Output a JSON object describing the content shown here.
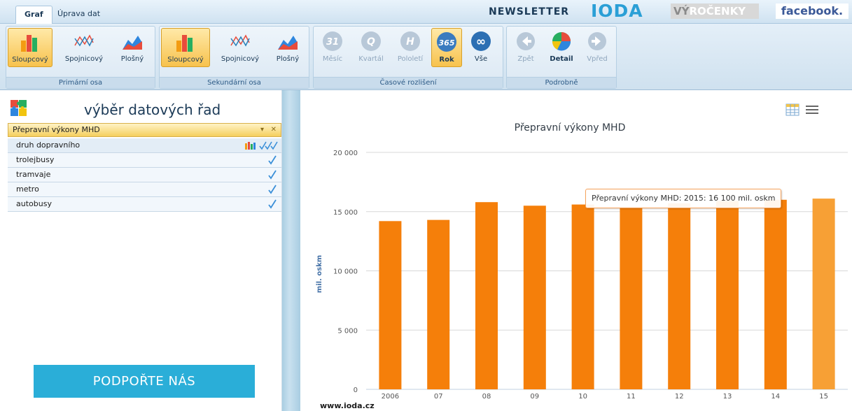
{
  "tabs": [
    {
      "label": "Graf",
      "active": true
    },
    {
      "label": "Úprava dat",
      "active": false
    }
  ],
  "toplinks": {
    "newsletter": "NEWSLETTER",
    "ioda": "IODA",
    "vyrocenky_a": "VÝ",
    "vyrocenky_b": "ROČENKY",
    "facebook": "facebook."
  },
  "ribbon": {
    "groups": [
      {
        "label": "Primární osa",
        "buttons": [
          {
            "label": "Sloupcový",
            "icon": "bar-chart-icon",
            "active": true
          },
          {
            "label": "Spojnicový",
            "icon": "line-chart-icon",
            "active": false
          },
          {
            "label": "Plošný",
            "icon": "area-chart-icon",
            "active": false
          }
        ]
      },
      {
        "label": "Sekundární osa",
        "buttons": [
          {
            "label": "Sloupcový",
            "icon": "bar-chart-icon",
            "active": true
          },
          {
            "label": "Spojnicový",
            "icon": "line-chart-icon",
            "active": false
          },
          {
            "label": "Plošný",
            "icon": "area-chart-icon",
            "active": false
          }
        ]
      },
      {
        "label": "Časové rozlišení",
        "buttons": [
          {
            "label": "Měsíc",
            "icon_text": "31",
            "active": false,
            "disabled": true
          },
          {
            "label": "Kvartál",
            "icon_text": "Q",
            "active": false,
            "disabled": true
          },
          {
            "label": "Pololetí",
            "icon_text": "H",
            "active": false,
            "disabled": true
          },
          {
            "label": "Rok",
            "icon_text": "365",
            "active": true,
            "disabled": false
          },
          {
            "label": "Vše",
            "icon_text": "∞",
            "active": false,
            "disabled": false
          }
        ]
      },
      {
        "label": "Podrobně",
        "buttons": [
          {
            "label": "Zpět",
            "icon": "arrow-left-icon",
            "active": false,
            "disabled": true
          },
          {
            "label": "Detail",
            "icon": "pie-chart-icon",
            "active": false,
            "disabled": false
          },
          {
            "label": "Vpřed",
            "icon": "arrow-right-icon",
            "active": false,
            "disabled": true
          }
        ]
      }
    ]
  },
  "leftpanel": {
    "title": "výběr datových řad",
    "series_name": "Přepravní výkony MHD",
    "rows": [
      {
        "label": "druh dopravního"
      },
      {
        "label": "trolejbusy"
      },
      {
        "label": "tramvaje"
      },
      {
        "label": "metro"
      },
      {
        "label": "autobusy"
      }
    ],
    "support_label": "PODPOŘTE NÁS"
  },
  "tooltip": "Přepravní výkony MHD: 2015: 16 100 mil. oskm",
  "credit": "www.ioda.cz",
  "colors": {
    "bar": "#f57f0a",
    "bar_hover": "#f7a035",
    "accent": "#2aaed8"
  },
  "chart_data": {
    "type": "bar",
    "title": "Přepravní výkony MHD",
    "xlabel": "",
    "ylabel": "mil. oskm",
    "categories": [
      "2006",
      "07",
      "08",
      "09",
      "10",
      "11",
      "12",
      "13",
      "14",
      "15"
    ],
    "values": [
      14200,
      14300,
      15800,
      15500,
      15600,
      15400,
      15700,
      15900,
      16000,
      16100
    ],
    "ylim": [
      0,
      20000
    ],
    "yticks": [
      "0",
      "5 000",
      "10 000",
      "15 000",
      "20 000"
    ],
    "ytick_values": [
      0,
      5000,
      10000,
      15000,
      20000
    ],
    "grid": true,
    "legend": "none"
  }
}
